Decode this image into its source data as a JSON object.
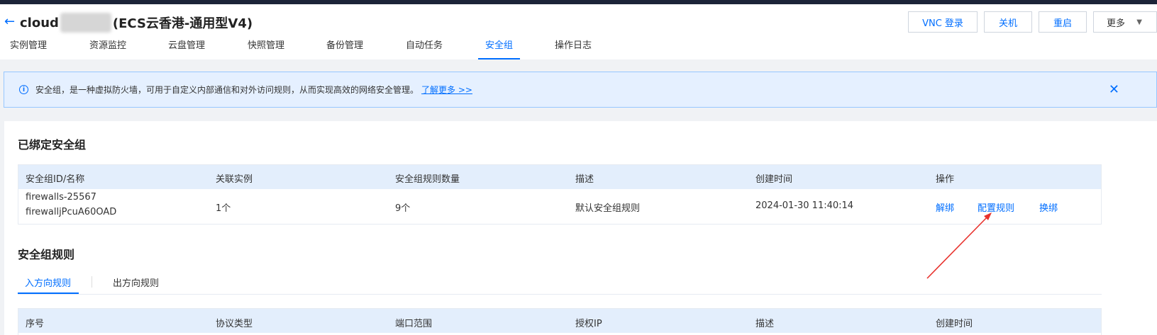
{
  "header": {
    "back_icon": "←",
    "title_prefix": "cloud",
    "title_suffix": "(ECS云香港-通用型V4)",
    "buttons": {
      "vnc": "VNC 登录",
      "shutdown": "关机",
      "restart": "重启",
      "more": "更多"
    }
  },
  "tabs": [
    "实例管理",
    "资源监控",
    "云盘管理",
    "快照管理",
    "备份管理",
    "自动任务",
    "安全组",
    "操作日志"
  ],
  "active_tab": "安全组",
  "notice": {
    "text": "安全组，是一种虚拟防火墙，可用于自定义内部通信和对外访问规则，从而实现高效的网络安全管理。",
    "link": "了解更多 >>"
  },
  "bound_section": {
    "title": "已绑定安全组",
    "columns": [
      "安全组ID/名称",
      "关联实例",
      "安全组规则数量",
      "描述",
      "创建时间",
      "操作"
    ],
    "row": {
      "id": "firewalls-25567",
      "name": "firewalljPcuA60OAD",
      "instances": "1个",
      "rule_count": "9个",
      "description": "默认安全组规则",
      "created": "2024-01-30 11:40:14",
      "actions": [
        "解绑",
        "配置规则",
        "换绑"
      ]
    }
  },
  "rules_section": {
    "title": "安全组规则",
    "subtabs": [
      "入方向规则",
      "出方向规则"
    ],
    "active_subtab": "入方向规则",
    "columns": [
      "序号",
      "协议类型",
      "端口范围",
      "授权IP",
      "描述",
      "创建时间"
    ]
  },
  "colors": {
    "accent": "#006eff",
    "annotation_arrow": "#e8322d"
  }
}
